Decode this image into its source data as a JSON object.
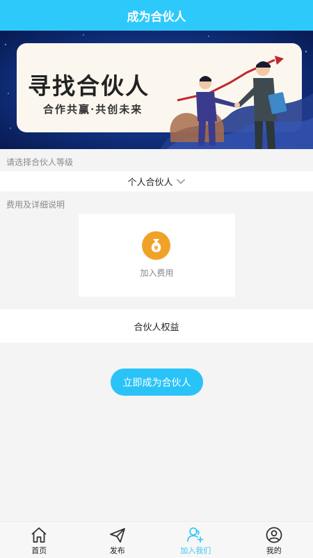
{
  "header": {
    "title": "成为合伙人"
  },
  "banner": {
    "title": "寻找合伙人",
    "subtitle": "合作共赢·共创未来"
  },
  "level": {
    "label": "请选择合伙人等级",
    "selected": "个人合伙人"
  },
  "fees": {
    "label": "费用及详细说明",
    "card_text": "加入费用",
    "icon": "money-bag-icon"
  },
  "benefits": {
    "label": "合伙人权益"
  },
  "cta": {
    "label": "立即成为合伙人"
  },
  "tabbar": {
    "items": [
      {
        "label": "首页",
        "icon": "home-icon"
      },
      {
        "label": "发布",
        "icon": "send-icon"
      },
      {
        "label": "加入我们",
        "icon": "join-icon",
        "active": true
      },
      {
        "label": "我的",
        "icon": "user-icon"
      }
    ]
  },
  "colors": {
    "primary": "#2ec9fb",
    "accent_orange": "#f0a228",
    "active_tab": "#3cc6f3"
  }
}
